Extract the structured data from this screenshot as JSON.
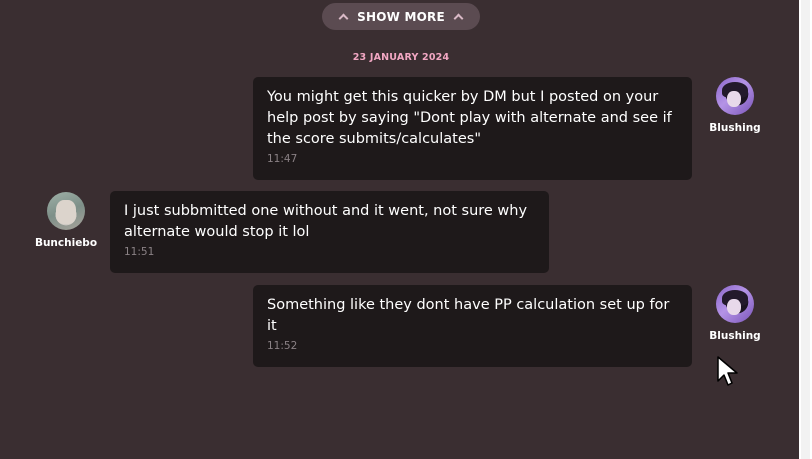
{
  "show_more": {
    "label": "SHOW MORE"
  },
  "date_divider": "23 JANUARY 2024",
  "messages": [
    {
      "author": "Blushing",
      "side": "right",
      "text": "You might get this quicker by DM but I posted on your help post by saying \"Dont play with alternate and see if the score submits/calculates\"",
      "time": "11:47"
    },
    {
      "author": "Bunchiebo",
      "side": "left",
      "text": "I just subbmitted one without and it went, not sure why alternate would stop it lol",
      "time": "11:51"
    },
    {
      "author": "Blushing",
      "side": "right",
      "text": "Something like they dont have PP calculation set up for it",
      "time": "11:52"
    }
  ],
  "icons": {
    "show_more": "chevron-up-icon",
    "cursor": "mouse-pointer-icon"
  },
  "colors": {
    "background": "#3a2e31",
    "bubble": "#1e191a",
    "date_accent": "#f2a7c3",
    "pill": "#5b4b51"
  }
}
